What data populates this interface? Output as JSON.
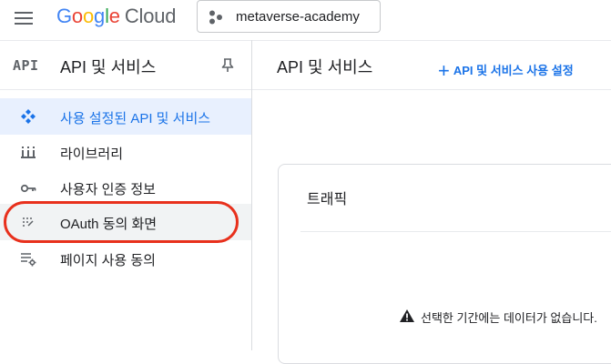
{
  "topbar": {
    "logo": {
      "google_letters": [
        "G",
        "o",
        "o",
        "g",
        "l",
        "e"
      ],
      "google_colors": [
        "#4285F4",
        "#EA4335",
        "#FBBC05",
        "#4285F4",
        "#34A853",
        "#EA4335"
      ],
      "cloud": "Cloud"
    },
    "project_name": "metaverse-academy"
  },
  "sidebar": {
    "badge": "API",
    "title": "API 및 서비스",
    "items": [
      {
        "label": "사용 설정된 API 및 서비스",
        "icon": "diamond-grid-icon",
        "active": true
      },
      {
        "label": "라이브러리",
        "icon": "library-icon"
      },
      {
        "label": "사용자 인증 정보",
        "icon": "key-icon"
      },
      {
        "label": "OAuth 동의 화면",
        "icon": "oauth-dots-icon",
        "highlighted": true
      },
      {
        "label": "페이지 사용 동의",
        "icon": "settings-list-icon"
      }
    ]
  },
  "main": {
    "title": "API 및 서비스",
    "action_label": "API 및 서비스 사용 설정",
    "card": {
      "title": "트래픽",
      "empty_message": "선택한 기간에는 데이터가 없습니다."
    }
  },
  "colors": {
    "accent": "#1a73e8",
    "highlight_ring": "#e8301c",
    "active_bg": "#e8f0fe"
  }
}
